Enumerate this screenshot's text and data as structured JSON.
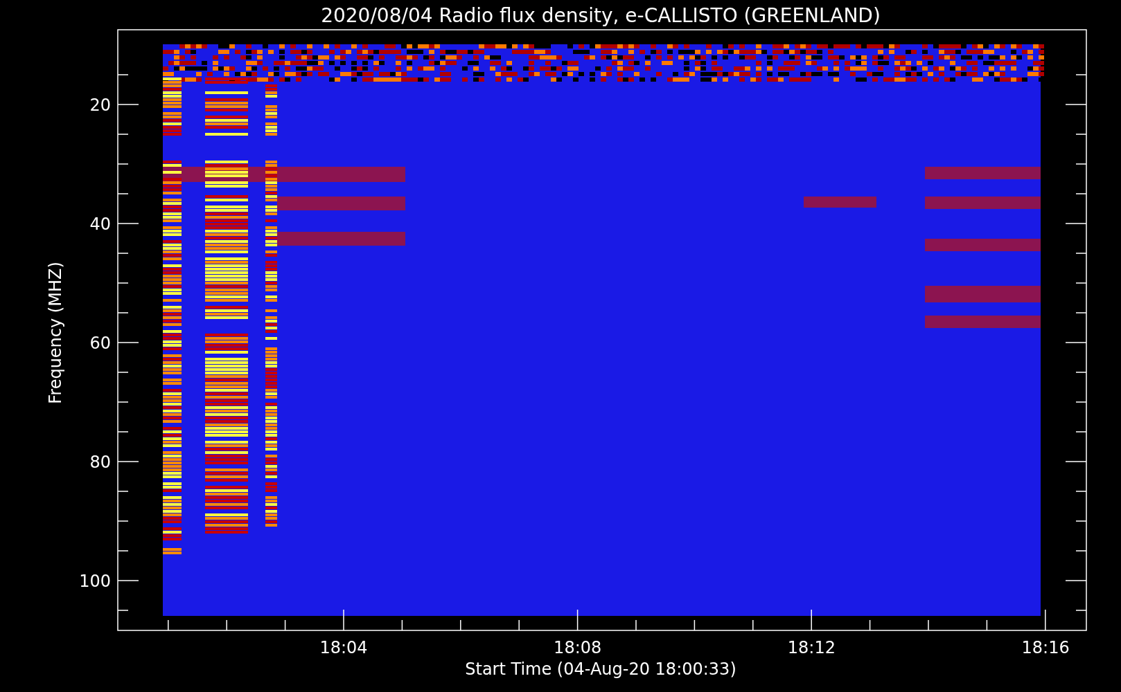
{
  "title": "2020/08/04  Radio flux density, e-CALLISTO (GREENLAND)",
  "chart": {
    "ylabel": "Frequency (MHZ)",
    "xlabel": "Start Time (04-Aug-20 18:00:33)",
    "yticks": [
      "20",
      "40",
      "60",
      "80",
      "100"
    ],
    "xticks": [
      "18:04",
      "18:08",
      "18:12",
      "18:16"
    ]
  }
}
